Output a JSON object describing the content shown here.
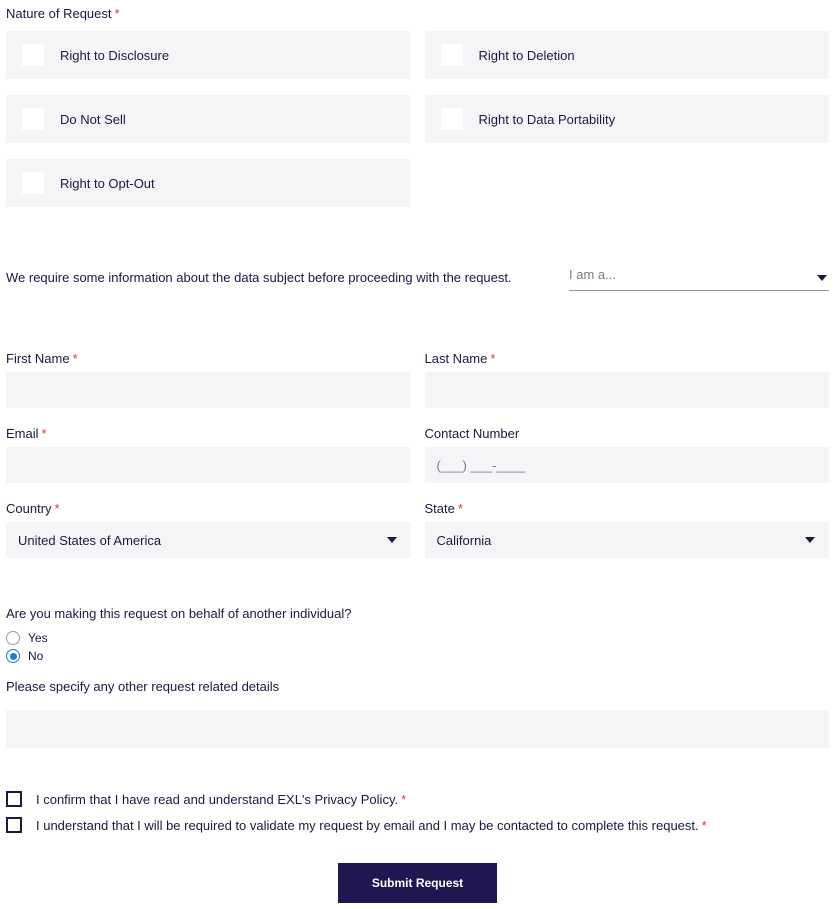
{
  "nature": {
    "title": "Nature of Request",
    "options": [
      "Right to Disclosure",
      "Right to Deletion",
      "Do Not Sell",
      "Right to Data Portability",
      "Right to Opt-Out"
    ]
  },
  "info_text": "We require some information about the data subject before proceeding with the request.",
  "i_am_a": {
    "label": "I am a..."
  },
  "fields": {
    "first_name": "First Name",
    "last_name": "Last Name",
    "email": "Email",
    "contact_number": "Contact Number",
    "contact_placeholder": "(___) ___-____",
    "country": "Country",
    "country_value": "United States of America",
    "state": "State",
    "state_value": "California"
  },
  "behalf": {
    "question": "Are you making this request on behalf of another individual?",
    "yes": "Yes",
    "no": "No",
    "selected": "No"
  },
  "details_label": "Please specify any other request related details",
  "confirm1": "I confirm that I have read and understand EXL's Privacy Policy.",
  "confirm2": "I understand that I will be required to validate my request by email and I may be contacted to complete this request.",
  "submit": "Submit Request"
}
